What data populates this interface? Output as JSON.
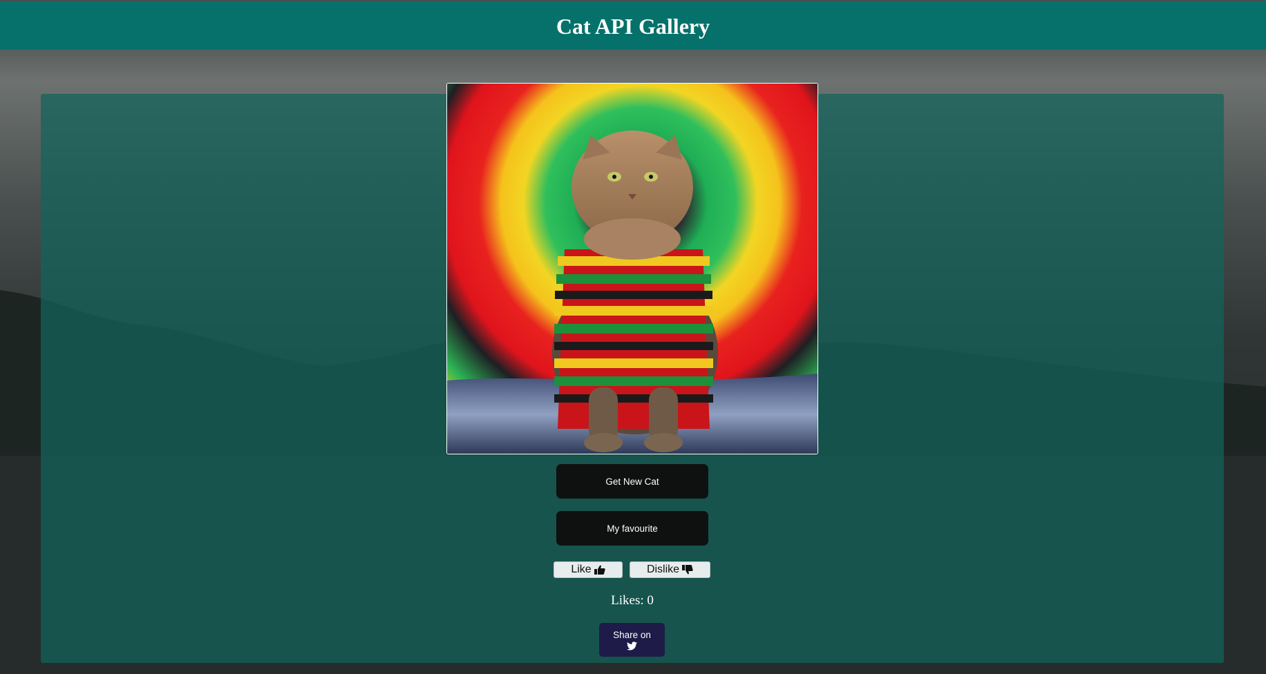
{
  "header": {
    "title": "Cat API Gallery"
  },
  "image": {
    "subject": "cat-in-rasta-sweater"
  },
  "buttons": {
    "new_cat": "Get New Cat",
    "favourite": "My favourite",
    "like": "Like",
    "dislike": "Dislike",
    "share": "Share on"
  },
  "likes": {
    "text": "Likes: 0"
  },
  "icons": {
    "like": "thumbs-up-icon",
    "dislike": "thumbs-down-icon",
    "share": "twitter-icon"
  },
  "colors": {
    "header_bg": "#06716b",
    "panel_bg": "#12645c",
    "dark_button": "#0f1111",
    "share_button": "#1e1b48",
    "light_button": "#e7ecec"
  }
}
